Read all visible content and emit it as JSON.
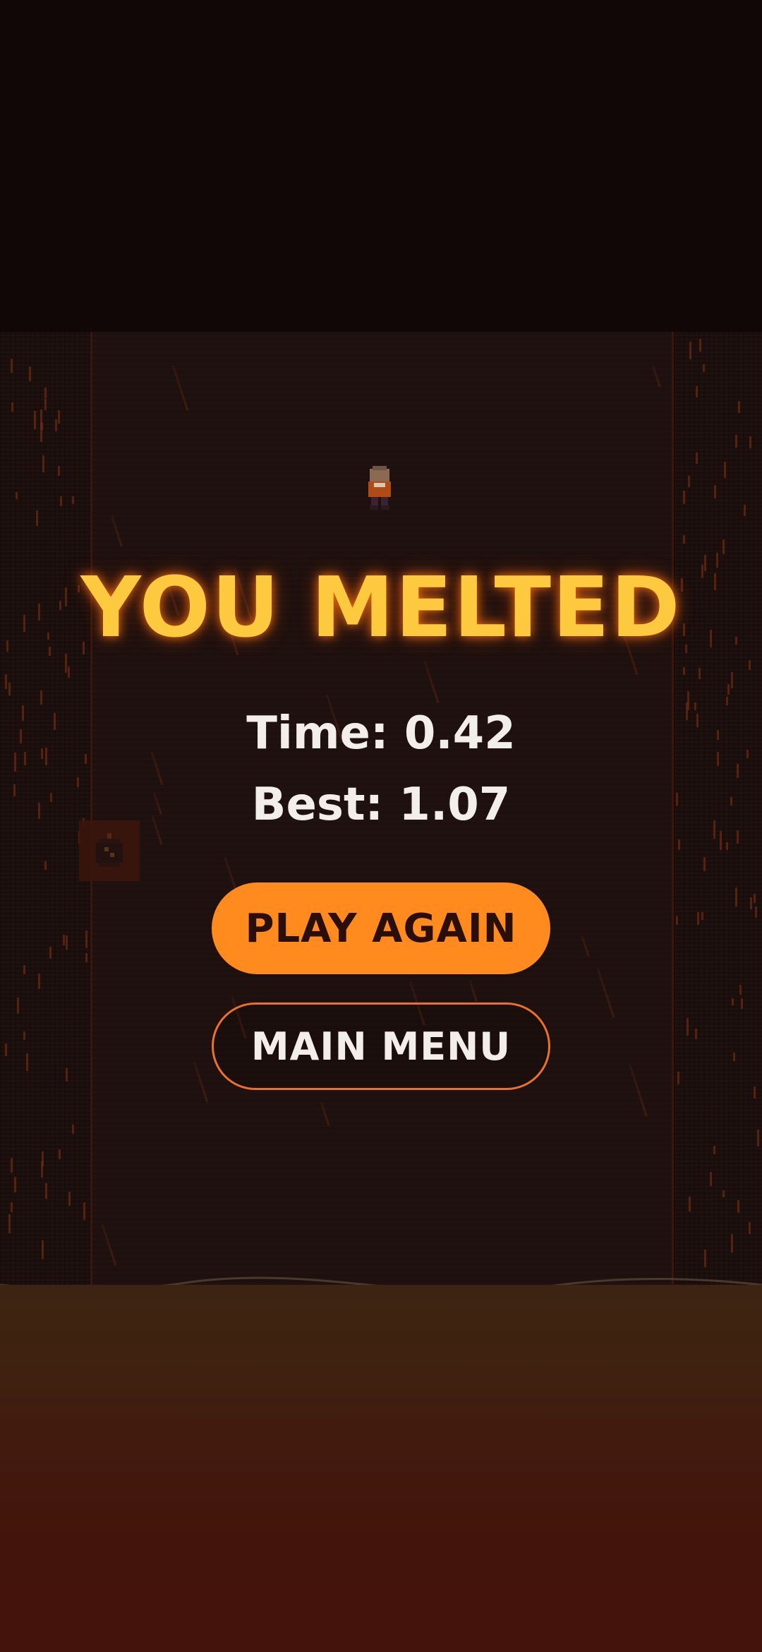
{
  "game_over": {
    "title": "YOU MELTED",
    "time_text": "Time: 0.42",
    "best_text": "Best: 1.07"
  },
  "buttons": {
    "play_again": "PLAY AGAIN",
    "main_menu": "MAIN MENU"
  },
  "colors": {
    "title": "#fcc93f",
    "play_button": "#ff8b1f",
    "menu_border": "#e9712a",
    "background": "#120707",
    "lava": "#43140c"
  },
  "icons": {
    "player": "player-character-icon",
    "item": "bomb-icon"
  }
}
